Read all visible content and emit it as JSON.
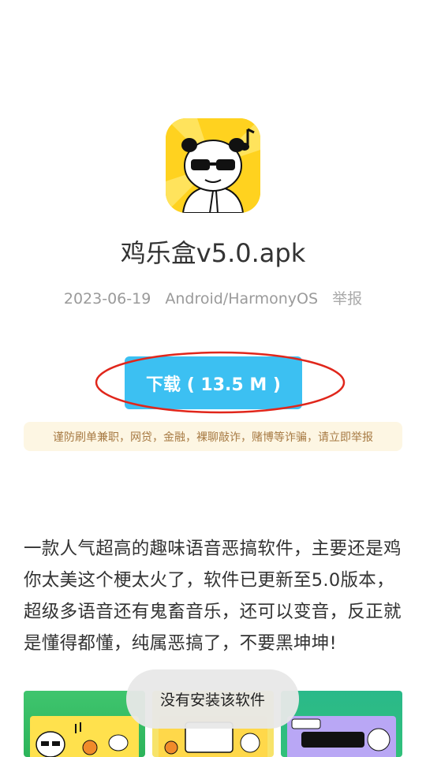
{
  "app": {
    "title": "鸡乐盒v5.0.apk",
    "date": "2023-06-19",
    "platform": "Android/HarmonyOS",
    "report_label": "举报"
  },
  "download": {
    "label": "下载 ( 13.5 M )"
  },
  "warning": {
    "text": "谨防刷单兼职，网贷，金融，裸聊敲诈，赌博等诈骗，请立即举报"
  },
  "description": {
    "text": "一款人气超高的趣味语音恶搞软件，主要还是鸡你太美这个梗太火了，软件已更新至5.0版本，超级多语音还有鬼畜音乐，还可以变音，反正就是懂得都懂，纯属恶搞了，不要黑坤坤!"
  },
  "toast": {
    "text": "没有安装该软件"
  },
  "colors": {
    "download_button": "#3cc0f2",
    "highlight_ellipse": "#e0261b",
    "warning_bg": "#fdf6e3",
    "warning_text": "#a77a43"
  },
  "icons": {
    "app_icon": "panda-meme-app-icon"
  }
}
